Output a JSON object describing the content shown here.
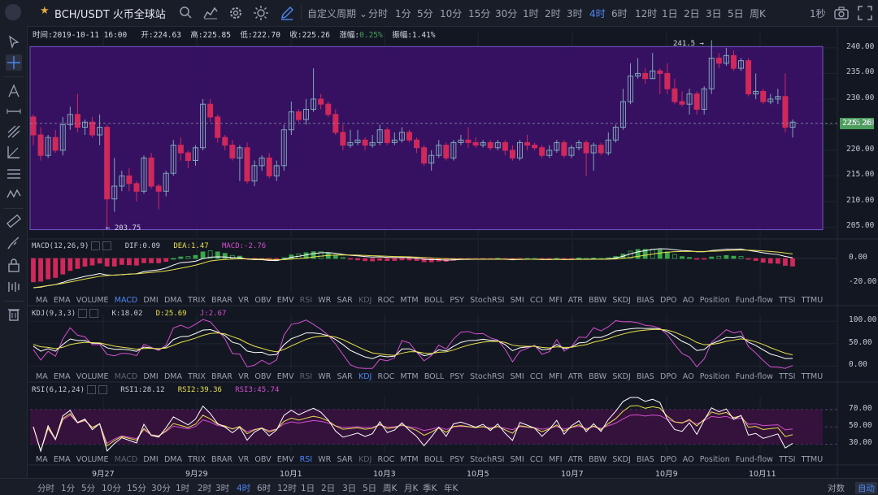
{
  "header": {
    "symbol": "BCH/USDT 火币全球站",
    "custom_period": "自定义周期",
    "periods": [
      "分时",
      "1分",
      "5分",
      "10分",
      "15分",
      "30分",
      "1时",
      "2时",
      "3时",
      "4时",
      "6时",
      "12时",
      "1日",
      "2日",
      "3日",
      "5日",
      "周K"
    ],
    "active_period": "4时",
    "refresh": "1秒"
  },
  "info_bar": {
    "time": "时间:2019-10-11 16:00",
    "open": "开:224.63",
    "high": "高:225.85",
    "low": "低:222.70",
    "close": "收:225.26",
    "change_label": "涨幅:",
    "change_value": "0.25%",
    "amplitude": "振幅:1.41%"
  },
  "price_chart": {
    "current_price": "225.26",
    "high_marker": "241.5 →",
    "low_marker": "← 203.75",
    "yticks": [
      "240.00",
      "235.00",
      "230.00",
      "225.00",
      "220.00",
      "215.00",
      "210.00",
      "205.00"
    ]
  },
  "macd": {
    "label": "MACD(12,26,9)",
    "dif": "DIF:0.09",
    "dea": "DEA:1.47",
    "macd": "MACD:-2.76",
    "yticks": [
      "0.00",
      "-20.00"
    ]
  },
  "kdj": {
    "label": "KDJ(9,3,3)",
    "k": "K:18.02",
    "d": "D:25.69",
    "j": "J:2.67",
    "yticks": [
      "100.00",
      "50.00",
      "0.00"
    ]
  },
  "rsi": {
    "label": "RSI(6,12,24)",
    "rsi1": "RSI1:28.12",
    "rsi2": "RSI2:39.36",
    "rsi3": "RSI3:45.74",
    "yticks": [
      "70.00",
      "50.00",
      "30.00"
    ]
  },
  "indicator_tabs": [
    "MA",
    "EMA",
    "VOLUME",
    "MACD",
    "DMI",
    "DMA",
    "TRIX",
    "BRAR",
    "VR",
    "OBV",
    "EMV",
    "RSI",
    "WR",
    "SAR",
    "KDJ",
    "ROC",
    "MTM",
    "BOLL",
    "PSY",
    "StochRSI",
    "SMI",
    "CCI",
    "MFI",
    "ATR",
    "BBW",
    "SKDJ",
    "BIAS",
    "DPO",
    "AO",
    "Position",
    "Fund-flow",
    "TTSI",
    "TTMU"
  ],
  "date_ticks": [
    "9月27",
    "9月29",
    "10月1",
    "10月3",
    "10月5",
    "10月7",
    "10月9",
    "10月11"
  ],
  "bottom_bar": {
    "periods": [
      "分时",
      "1分",
      "5分",
      "10分",
      "15分",
      "30分",
      "1时",
      "2时",
      "3时",
      "4时",
      "6时",
      "12时",
      "1日",
      "2日",
      "3日",
      "5日",
      "周K",
      "月K",
      "季K",
      "年K"
    ],
    "active_period": "4时",
    "log": "对数",
    "auto": "自动"
  },
  "colors": {
    "up": "#4a9d5b",
    "down": "#d0285a",
    "candle_up_outline": "#7ea6b8",
    "highlight_box": "#3a1168",
    "highlight_border": "#7b5ad6",
    "dif": "#ffffff",
    "dea": "#e8e04a",
    "k_line": "#ffffff",
    "d_line": "#e8e04a",
    "j_line": "#d44fd0",
    "rsi1": "#ffffff",
    "rsi2": "#e8e04a",
    "rsi3": "#d44fd0",
    "accent": "#4d86f2"
  },
  "chart_data": {
    "type": "candlestick",
    "title": "BCH/USDT 火币全球站",
    "interval": "4时",
    "ylim": [
      203,
      243
    ],
    "candles": [
      [
        226.5,
        223.0,
        221.0,
        227.0
      ],
      [
        223.0,
        219.0,
        218.0,
        224.5
      ],
      [
        219.0,
        222.5,
        218.5,
        223.0
      ],
      [
        222.5,
        220.0,
        219.5,
        224.0
      ],
      [
        220.0,
        225.0,
        219.0,
        226.5
      ],
      [
        225.0,
        227.0,
        224.0,
        228.5
      ],
      [
        227.0,
        224.5,
        223.5,
        231.0
      ],
      [
        224.5,
        225.5,
        223.0,
        226.0
      ],
      [
        225.5,
        223.0,
        222.5,
        226.5
      ],
      [
        223.0,
        224.5,
        221.0,
        227.0
      ],
      [
        224.5,
        210.5,
        205.0,
        225.0
      ],
      [
        210.5,
        213.0,
        208.0,
        218.5
      ],
      [
        213.0,
        215.0,
        212.0,
        216.0
      ],
      [
        215.0,
        213.5,
        212.0,
        216.5
      ],
      [
        213.5,
        212.0,
        210.0,
        214.0
      ],
      [
        212.0,
        218.5,
        211.5,
        219.0
      ],
      [
        218.5,
        213.0,
        212.5,
        219.5
      ],
      [
        213.0,
        212.0,
        208.5,
        213.5
      ],
      [
        212.0,
        215.5,
        211.0,
        216.0
      ],
      [
        215.5,
        221.0,
        215.0,
        222.0
      ],
      [
        221.0,
        219.5,
        218.0,
        222.5
      ],
      [
        219.5,
        218.0,
        216.5,
        220.0
      ],
      [
        218.0,
        220.5,
        217.0,
        221.0
      ],
      [
        220.5,
        229.0,
        220.0,
        230.0
      ],
      [
        229.0,
        226.5,
        225.5,
        230.0
      ],
      [
        226.5,
        222.5,
        221.5,
        227.0
      ],
      [
        222.5,
        221.0,
        220.0,
        223.0
      ],
      [
        221.0,
        218.5,
        218.0,
        222.0
      ],
      [
        218.5,
        220.5,
        214.0,
        221.0
      ],
      [
        220.5,
        214.0,
        213.5,
        221.5
      ],
      [
        214.0,
        217.0,
        213.0,
        218.0
      ],
      [
        217.0,
        218.5,
        216.0,
        219.0
      ],
      [
        218.5,
        215.0,
        214.5,
        219.5
      ],
      [
        215.0,
        217.0,
        214.0,
        218.0
      ],
      [
        217.0,
        224.0,
        216.0,
        225.0
      ],
      [
        224.0,
        227.5,
        223.0,
        229.5
      ],
      [
        227.5,
        226.0,
        225.5,
        228.0
      ],
      [
        226.0,
        228.0,
        225.0,
        230.0
      ],
      [
        228.0,
        230.0,
        227.5,
        236.0
      ],
      [
        230.0,
        229.0,
        228.0,
        231.0
      ],
      [
        229.0,
        227.0,
        226.5,
        229.5
      ],
      [
        227.0,
        223.5,
        223.0,
        228.0
      ],
      [
        223.5,
        221.0,
        220.0,
        225.0
      ],
      [
        221.0,
        221.5,
        220.5,
        224.0
      ],
      [
        221.5,
        222.0,
        221.0,
        224.0
      ],
      [
        222.0,
        221.0,
        220.0,
        222.5
      ],
      [
        221.0,
        221.5,
        220.5,
        223.0
      ],
      [
        221.5,
        224.0,
        221.0,
        225.0
      ],
      [
        224.0,
        221.5,
        221.0,
        224.5
      ],
      [
        221.5,
        222.0,
        221.0,
        223.5
      ],
      [
        222.0,
        223.5,
        221.5,
        224.5
      ],
      [
        223.5,
        222.0,
        221.5,
        224.0
      ],
      [
        222.0,
        220.5,
        219.5,
        222.5
      ],
      [
        220.5,
        217.5,
        217.0,
        221.0
      ],
      [
        217.5,
        219.0,
        216.0,
        220.0
      ],
      [
        219.0,
        221.0,
        218.5,
        222.0
      ],
      [
        221.0,
        218.5,
        218.0,
        221.5
      ],
      [
        218.5,
        221.5,
        218.0,
        222.0
      ],
      [
        221.5,
        222.0,
        221.0,
        223.0
      ],
      [
        222.0,
        221.5,
        220.5,
        224.5
      ],
      [
        221.5,
        221.0,
        220.5,
        222.5
      ],
      [
        221.0,
        221.5,
        220.5,
        222.0
      ],
      [
        221.5,
        220.5,
        220.0,
        222.0
      ],
      [
        220.5,
        221.5,
        220.0,
        222.0
      ],
      [
        221.5,
        220.0,
        219.0,
        222.0
      ],
      [
        220.0,
        218.5,
        218.0,
        221.0
      ],
      [
        218.5,
        221.5,
        218.0,
        222.0
      ],
      [
        221.5,
        221.0,
        220.0,
        223.0
      ],
      [
        221.0,
        220.5,
        220.0,
        221.5
      ],
      [
        220.5,
        219.0,
        218.5,
        221.0
      ],
      [
        219.0,
        220.0,
        218.5,
        221.0
      ],
      [
        220.0,
        221.5,
        219.5,
        222.0
      ],
      [
        221.5,
        219.0,
        218.5,
        222.0
      ],
      [
        219.0,
        220.5,
        218.5,
        221.0
      ],
      [
        220.5,
        221.5,
        220.0,
        222.0
      ],
      [
        221.5,
        219.5,
        215.0,
        222.0
      ],
      [
        219.5,
        221.0,
        216.0,
        221.5
      ],
      [
        221.0,
        219.5,
        219.0,
        221.5
      ],
      [
        219.5,
        222.0,
        219.0,
        223.5
      ],
      [
        222.0,
        224.5,
        221.5,
        225.0
      ],
      [
        224.5,
        229.5,
        224.0,
        232.0
      ],
      [
        229.5,
        234.5,
        229.0,
        237.0
      ],
      [
        234.5,
        235.0,
        234.0,
        238.0
      ],
      [
        235.0,
        234.0,
        233.0,
        236.0
      ],
      [
        234.0,
        235.5,
        234.0,
        239.0
      ],
      [
        235.5,
        235.0,
        231.0,
        236.0
      ],
      [
        235.0,
        232.0,
        231.0,
        237.0
      ],
      [
        232.0,
        229.5,
        229.0,
        234.0
      ],
      [
        229.5,
        229.0,
        228.5,
        231.5
      ],
      [
        229.0,
        231.0,
        227.0,
        232.0
      ],
      [
        231.0,
        228.0,
        227.0,
        231.5
      ],
      [
        228.0,
        232.0,
        227.0,
        232.5
      ],
      [
        232.0,
        238.0,
        231.0,
        241.5
      ],
      [
        238.0,
        237.0,
        236.0,
        239.0
      ],
      [
        237.0,
        238.5,
        236.5,
        240.0
      ],
      [
        238.5,
        236.0,
        235.5,
        239.5
      ],
      [
        236.0,
        237.5,
        235.5,
        238.0
      ],
      [
        237.5,
        231.0,
        230.5,
        238.0
      ],
      [
        231.0,
        231.5,
        230.0,
        235.0
      ],
      [
        231.5,
        229.5,
        229.0,
        232.0
      ],
      [
        229.5,
        230.0,
        229.0,
        231.0
      ],
      [
        230.0,
        230.5,
        229.0,
        232.0
      ],
      [
        230.5,
        224.5,
        223.5,
        235.0
      ],
      [
        224.5,
        225.5,
        222.5,
        226.0
      ]
    ],
    "macd": {
      "dif": 0.09,
      "dea": 1.47,
      "hist": -2.76,
      "ylim": [
        -28,
        8
      ]
    },
    "kdj": {
      "k": 18.02,
      "d": 25.69,
      "j": 2.67,
      "ylim": [
        -10,
        115
      ]
    },
    "rsi": {
      "rsi1": 28.12,
      "rsi2": 39.36,
      "rsi3": 45.74,
      "ylim": [
        20,
        85
      ]
    }
  }
}
